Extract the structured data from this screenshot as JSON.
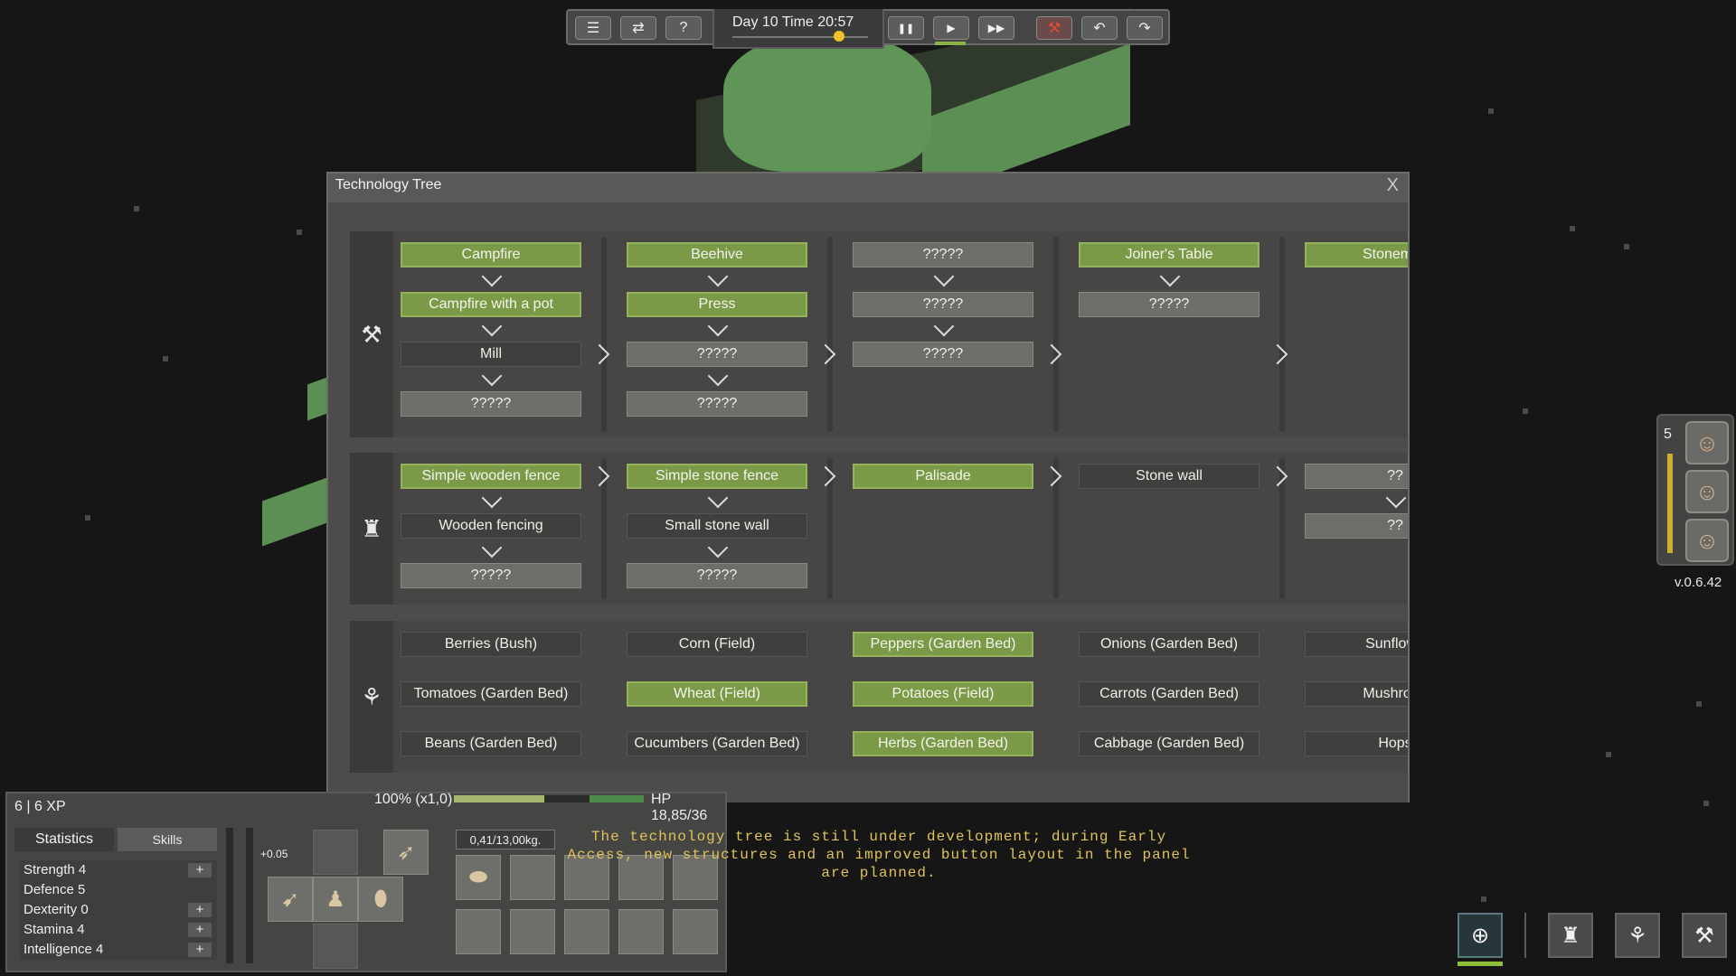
{
  "topbar": {
    "menu_icon": "menu-icon",
    "shuffle_icon": "shuffle-icon",
    "help_label": "?",
    "clock": "Day 10    Time 20:57",
    "pause_icon": "pause-icon",
    "play_icon": "play-icon",
    "fast_forward_icon": "fast-forward-icon",
    "demolish_icon": "red-hammer-icon",
    "undo_icon": "undo-icon",
    "redo_icon": "redo-icon",
    "play_label": "▶",
    "pause_label": "❚❚",
    "ff_label": "▶▶",
    "undo_label": "↶",
    "redo_label": "↷",
    "demolish_label": "⚒",
    "shuffle_label": "⇄",
    "menu_label": "☰"
  },
  "tech_tree": {
    "title": "Technology Tree",
    "close_label": "X",
    "rows": [
      {
        "category_icon": "hammer-icon",
        "category_label": "⚒",
        "columns": [
          [
            "Campfire",
            "Campfire with a pot",
            "Mill",
            "?????"
          ],
          [
            "Beehive",
            "Press",
            "?????",
            "?????"
          ],
          [
            "?????",
            "?????",
            "?????"
          ],
          [
            "Joiner's Table",
            "?????"
          ],
          [
            "Stonemas"
          ]
        ]
      },
      {
        "category_icon": "castle-tower-icon",
        "category_label": "♜",
        "columns": [
          [
            "Simple wooden fence",
            "Wooden fencing",
            "?????"
          ],
          [
            "Simple stone fence",
            "Small stone wall",
            "?????"
          ],
          [
            "Palisade"
          ],
          [
            "Stone wall"
          ],
          [
            "??",
            "??"
          ]
        ]
      },
      {
        "category_icon": "wheat-icon",
        "category_label": "⚘",
        "columns": [
          [
            "Berries (Bush)",
            "Tomatoes (Garden Bed)",
            "Beans (Garden Bed)"
          ],
          [
            "Corn (Field)",
            "Wheat (Field)",
            "Cucumbers (Garden Bed)"
          ],
          [
            "Peppers (Garden Bed)",
            "Potatoes (Field)",
            "Herbs (Garden Bed)"
          ],
          [
            "Onions (Garden Bed)",
            "Carrots (Garden Bed)",
            "Cabbage (Garden Bed)"
          ],
          [
            "Sunflowe",
            "Mushroon",
            "Hops"
          ]
        ]
      }
    ]
  },
  "team": {
    "count": "5",
    "portrait_icon": "settler-face-icon",
    "portrait_label": "☺"
  },
  "version": "v.0.6.42",
  "character": {
    "xp": "6 | 6 XP",
    "load_percent": "100% (x1,0)",
    "hp": "HP 18,85/36",
    "tabs": [
      "Statistics",
      "Skills"
    ],
    "stats": [
      {
        "label": "Strength 4",
        "plus": "+"
      },
      {
        "label": "Defence 5",
        "plus": ""
      },
      {
        "label": "Dexterity 0",
        "plus": "+"
      },
      {
        "label": "Stamina 4",
        "plus": "+"
      },
      {
        "label": "Intelligence 4",
        "plus": "+"
      }
    ],
    "increment": "+0.05",
    "weight": "0,41/13,00kg."
  },
  "notice": "The technology tree is still under development; during Early Access, new structures and an improved button layout in the panel are planned.",
  "bottom_right": {
    "build_icon": "tree-plus-icon",
    "defense_icon": "castle-tower-icon",
    "farm_icon": "wheat-icon",
    "craft_icon": "hammer-icon",
    "build_label": "⊕",
    "defense_label": "♜",
    "farm_label": "⚘",
    "craft_label": "⚒"
  }
}
